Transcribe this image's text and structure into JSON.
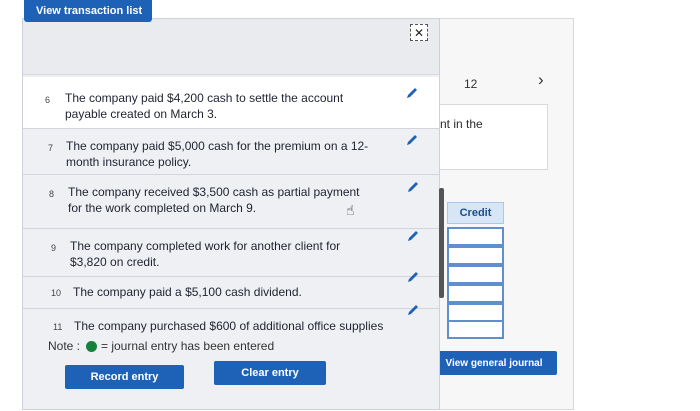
{
  "header": {
    "view_transaction_list_label": "View transaction list"
  },
  "background": {
    "page_number": "12",
    "next_icon": "chevron-right-icon",
    "partial_text": "nt in the",
    "credit_header": "Credit",
    "view_general_journal_label": "View general journal"
  },
  "transactions": [
    {
      "number": "6",
      "line1": "The company paid $4,200 cash to settle the account",
      "line2": "payable created on March 3."
    },
    {
      "number": "7",
      "line1": "The company paid $5,000 cash for the premium on a 12-",
      "line2": "month insurance policy."
    },
    {
      "number": "8",
      "line1": "The company received $3,500 cash as partial payment",
      "line2": "for the work completed on March 9."
    },
    {
      "number": "9",
      "line1": "The company completed work for another client for",
      "line2": "$3,820 on credit."
    },
    {
      "number": "10",
      "line1": "The company paid a $5,100 cash dividend.",
      "line2": ""
    },
    {
      "number": "11",
      "line1": "The company purchased $600 of additional office supplies",
      "line2": ""
    }
  ],
  "note": {
    "label": "Note :",
    "text": "= journal entry has been entered",
    "dot_color": "#16813b"
  },
  "buttons": {
    "record_entry": "Record entry",
    "clear_entry": "Clear entry"
  },
  "icons": {
    "close": "close-icon",
    "edit": "pencil-icon",
    "cursor": "hand-pointer-icon"
  },
  "colors": {
    "accent": "#1e62b8"
  }
}
